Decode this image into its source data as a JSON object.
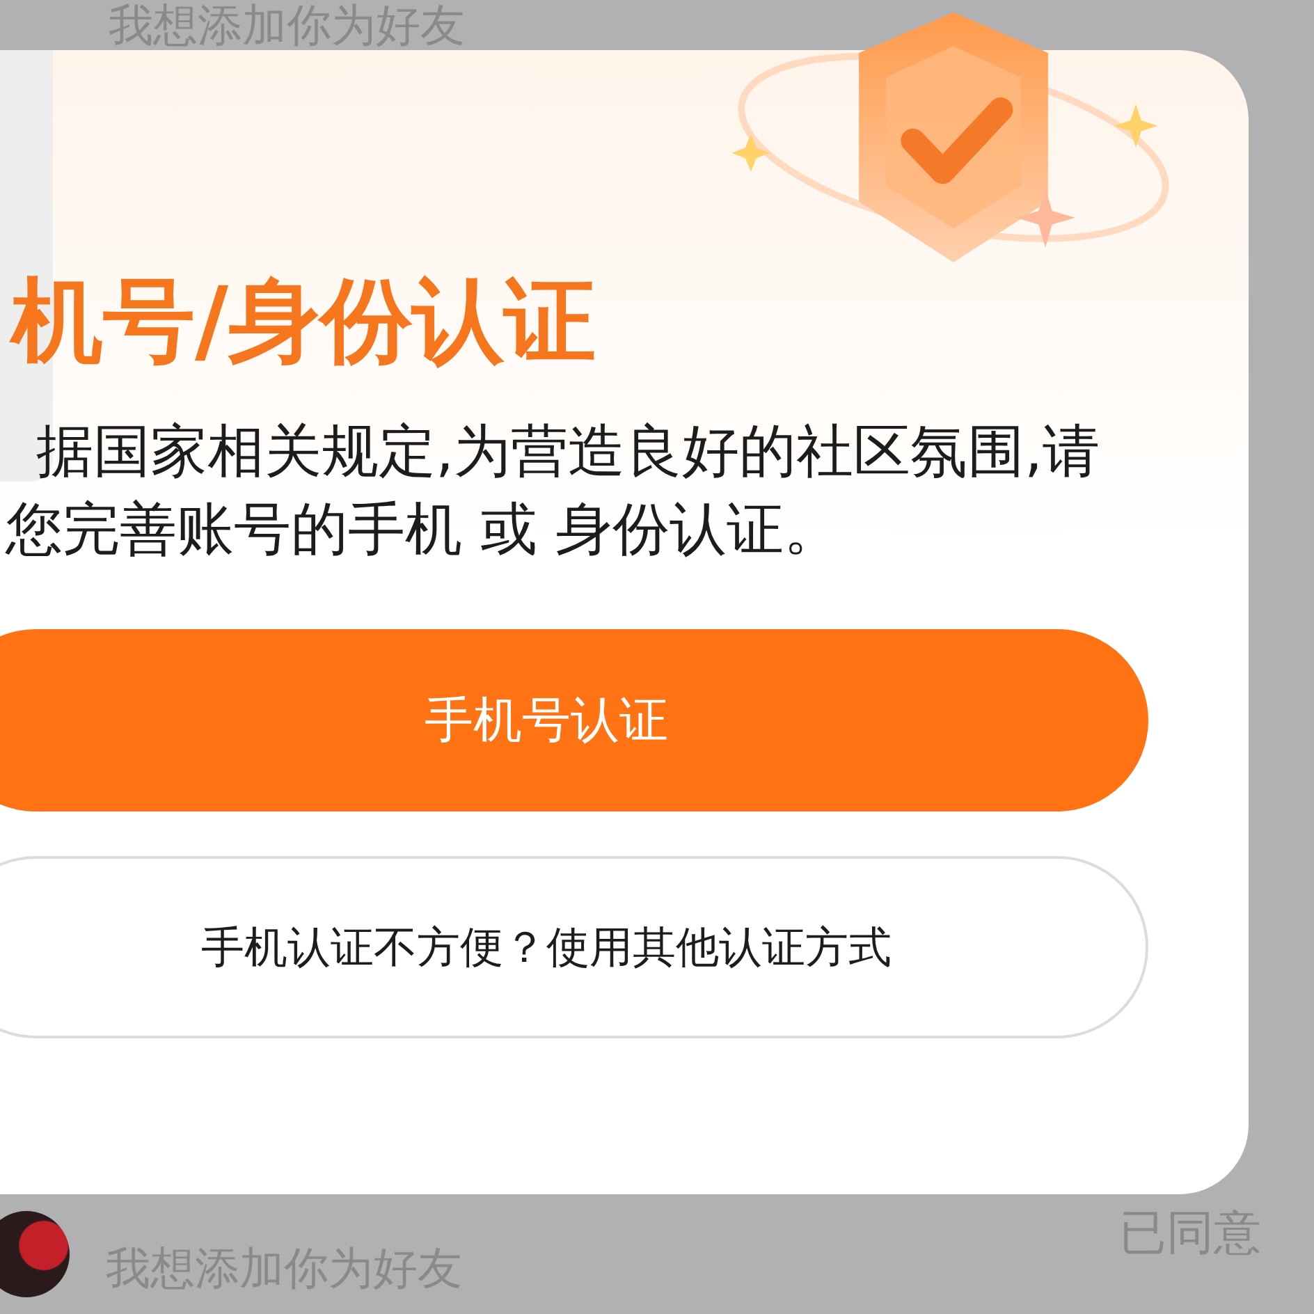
{
  "background_list": {
    "top_row": {
      "message": "我想添加你为好友"
    },
    "bottom_row": {
      "message": "我想添加你为好友",
      "status": "已同意"
    }
  },
  "dialog": {
    "title": "机号/身份认证",
    "description": [
      "据国家相关规定,为营造良好的社区氛围,请",
      "您完善账号的手机 或 身份认证。"
    ],
    "buttons": [
      {
        "label": "手机号认证",
        "kind": "primary"
      },
      {
        "label": "手机认证不方便？使用其他认证方式",
        "kind": "outline"
      }
    ]
  }
}
